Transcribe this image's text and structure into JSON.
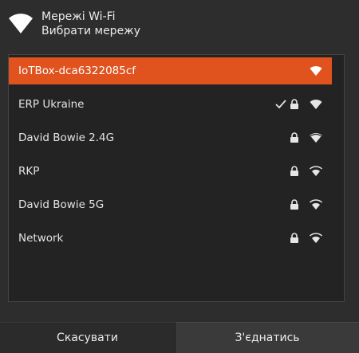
{
  "header": {
    "title": "Мережі Wi-Fi",
    "subtitle": "Вибрати мережу",
    "icon": "wifi-icon"
  },
  "networks": [
    {
      "name": "IoTBox-dca6322085cf",
      "selected": true,
      "connected": false,
      "secured": false,
      "signal": "strong"
    },
    {
      "name": "ERP Ukraine",
      "selected": false,
      "connected": true,
      "secured": true,
      "signal": "strong"
    },
    {
      "name": "David Bowie 2.4G",
      "selected": false,
      "connected": false,
      "secured": true,
      "signal": "strong"
    },
    {
      "name": "RKP",
      "selected": false,
      "connected": false,
      "secured": true,
      "signal": "medium"
    },
    {
      "name": "David Bowie 5G",
      "selected": false,
      "connected": false,
      "secured": true,
      "signal": "medium"
    },
    {
      "name": "Network",
      "selected": false,
      "connected": false,
      "secured": true,
      "signal": "medium"
    }
  ],
  "footer": {
    "cancel_label": "Скасувати",
    "connect_label": "З'єднатись"
  },
  "colors": {
    "accent": "#e0521e",
    "background": "#2d2d2d",
    "list_background": "#232323"
  }
}
